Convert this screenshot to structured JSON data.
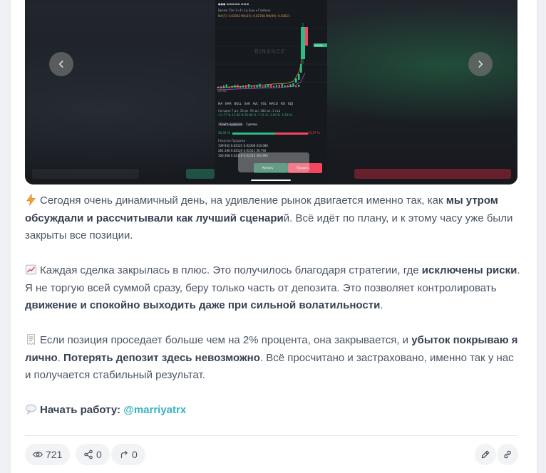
{
  "media": {
    "prev_icon": "chevron-left-icon",
    "next_icon": "chevron-right-icon",
    "screenshot": {
      "app": "Binance",
      "watermark": "BINANCE",
      "timeframe_row": "Время   15м   1ч   4ч   1д   Еще ▾   Глубина",
      "ma_row": "MA(7): 0.02942   MA(25): 0.02768   MA(99): 0.02611",
      "price_high": "0.02136",
      "price_low": "0.01720",
      "indicators": [
        "MA",
        "EMA",
        "BOLL",
        "SAR",
        "AVL",
        "VOL",
        "MACD",
        "RSI",
        "KDJ"
      ],
      "stats_row": "Сегодня   7 дн.   30 дн.   90 дн.   180 дн.   1 год",
      "stats_values": "-11.77 %   11.56 %   35.96 %   -7.31 %   -3.00 %   -1.19 %",
      "tabs": [
        "Книга ордеров",
        "Сделки"
      ],
      "buy_pct": "56.03 %",
      "sell_pct": "43.17 %",
      "book_header": "Покупка          Продажа",
      "book_rows": [
        "139.932   0.02121   0.02308   410.080",
        "261.190   0.02120   0.02311   56.792",
        "106.308   0.02119   0.02312   364.990"
      ],
      "buy_label": "Купить",
      "sell_label": "Продать"
    },
    "colors": {
      "up": "#2ebd85",
      "down": "#f6465d",
      "chart_bg": "#161a1e"
    }
  },
  "post": {
    "p1": {
      "icon": "lightning-icon",
      "t1": "Сегодня очень динамичный день, на удивление рынок двигается именно так, как ",
      "b1": "мы утром обсуждали и рассчитывали как лучший сценари",
      "t2": "й. Всё идёт по плану, и к этому часу уже были закрыты все позиции."
    },
    "p2": {
      "icon": "chart-increasing-icon",
      "t1": "Каждая сделка закрылась в плюс. Это получилось благодаря стратегии, где ",
      "b1": "исключены риски",
      "t2": ". Я не торгую всей суммой сразу, беру только часть от депозита. Это позволяет контролировать ",
      "b2": "движение и спокойно выходить даже при сильной волатильности",
      "t3": "."
    },
    "p3": {
      "icon": "receipt-icon",
      "t1": "Если позиция проседает больше чем на 2% процента, она закрывается, и ",
      "b1": "убыток покрываю я лично",
      "t2": ". ",
      "b2": "Потерять депозит здесь невозможно",
      "t3": ". Всё просчитано и застраховано, именно так у нас и получается стабильный результат."
    },
    "p4": {
      "icon": "speech-balloon-icon",
      "b1": "Начать работу: ",
      "link": "@marriyatrx"
    }
  },
  "footer": {
    "views": "721",
    "shares": "0",
    "forwards": "0",
    "edit_icon": "pencil-icon",
    "link_icon": "link-icon"
  }
}
